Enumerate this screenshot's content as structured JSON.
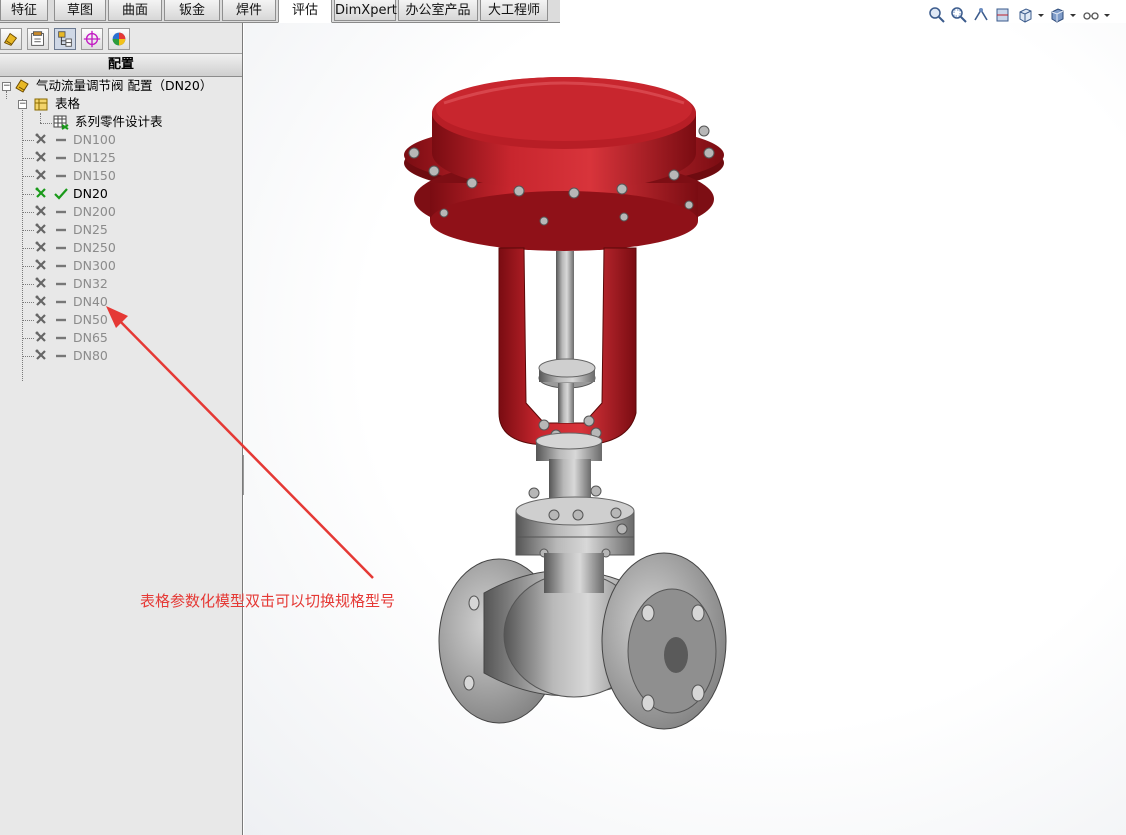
{
  "tabs": [
    {
      "label": "特征",
      "active": false
    },
    {
      "label": "草图",
      "active": false
    },
    {
      "label": "曲面",
      "active": false
    },
    {
      "label": "钣金",
      "active": false
    },
    {
      "label": "焊件",
      "active": false
    },
    {
      "label": "评估",
      "active": true
    },
    {
      "label": "DimXpert",
      "active": false
    },
    {
      "label": "办公室产品",
      "active": false
    },
    {
      "label": "大工程师",
      "active": false
    }
  ],
  "toolbar_icons": [
    "zoom-to-fit-icon",
    "zoom-area-icon",
    "previous-view-icon",
    "section-view-icon",
    "view-orientation-icon",
    "display-style-icon",
    "hide-show-items-icon"
  ],
  "panel": {
    "tab_icons": [
      "feature-manager-icon",
      "property-manager-icon",
      "configuration-manager-icon",
      "dimxpert-manager-icon",
      "display-manager-icon"
    ],
    "title": "配置",
    "root_label": "气动流量调节阀 配置（DN20）",
    "tables_folder": "表格",
    "design_table": "系列零件设计表",
    "configurations": [
      {
        "label": "DN100",
        "active": false
      },
      {
        "label": "DN125",
        "active": false
      },
      {
        "label": "DN150",
        "active": false
      },
      {
        "label": "DN20",
        "active": true
      },
      {
        "label": "DN200",
        "active": false
      },
      {
        "label": "DN25",
        "active": false
      },
      {
        "label": "DN250",
        "active": false
      },
      {
        "label": "DN300",
        "active": false
      },
      {
        "label": "DN32",
        "active": false
      },
      {
        "label": "DN40",
        "active": false
      },
      {
        "label": "DN50",
        "active": false
      },
      {
        "label": "DN65",
        "active": false
      },
      {
        "label": "DN80",
        "active": false
      }
    ]
  },
  "annotation": "表格参数化模型双击可以切换规格型号",
  "colors": {
    "actuator_red": "#c0202a",
    "body_gray": "#9a9a9a",
    "annotation_red": "#e53935",
    "active_check": "#1a9a1a"
  }
}
